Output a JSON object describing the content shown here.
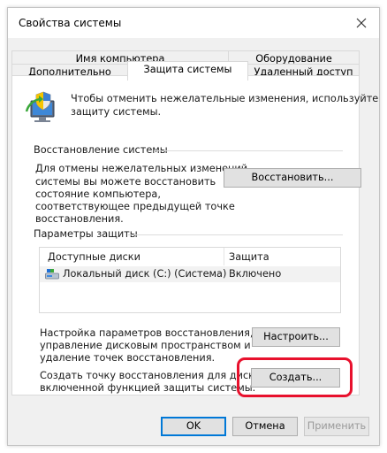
{
  "window": {
    "title": "Свойства системы"
  },
  "tabs_back": [
    "Имя компьютера",
    "Оборудование"
  ],
  "tabs_front": [
    "Дополнительно",
    "Защита системы",
    "Удаленный доступ"
  ],
  "intro": {
    "line1": "Чтобы отменить нежелательные изменения, используйте",
    "line2": "защиту системы."
  },
  "restore": {
    "heading": "Восстановление системы",
    "lines": [
      "Для отмены нежелательных изменений",
      "системы вы можете восстановить",
      "состояние компьютера,",
      "соответствующее предыдущей точке",
      "восстановления."
    ],
    "button": "Восстановить..."
  },
  "protection": {
    "heading": "Параметры защиты",
    "columns": [
      "Доступные диски",
      "Защита"
    ],
    "rows": [
      {
        "drive": "Локальный диск (C:) (Система)",
        "status": "Включено",
        "icon": "drive-icon"
      }
    ]
  },
  "configure": {
    "lines": [
      "Настройка параметров восстановления,",
      "управление дисковым пространством и",
      "удаление точек восстановления."
    ],
    "button": "Настроить..."
  },
  "create": {
    "lines": [
      "Создать точку восстановления для дисков с",
      "включенной функцией защиты системы."
    ],
    "button": "Создать..."
  },
  "footer": {
    "ok": "OK",
    "cancel": "Отмена",
    "apply": "Применить"
  },
  "colors": {
    "highlight": "#e8112d",
    "focus": "#0078d7"
  }
}
